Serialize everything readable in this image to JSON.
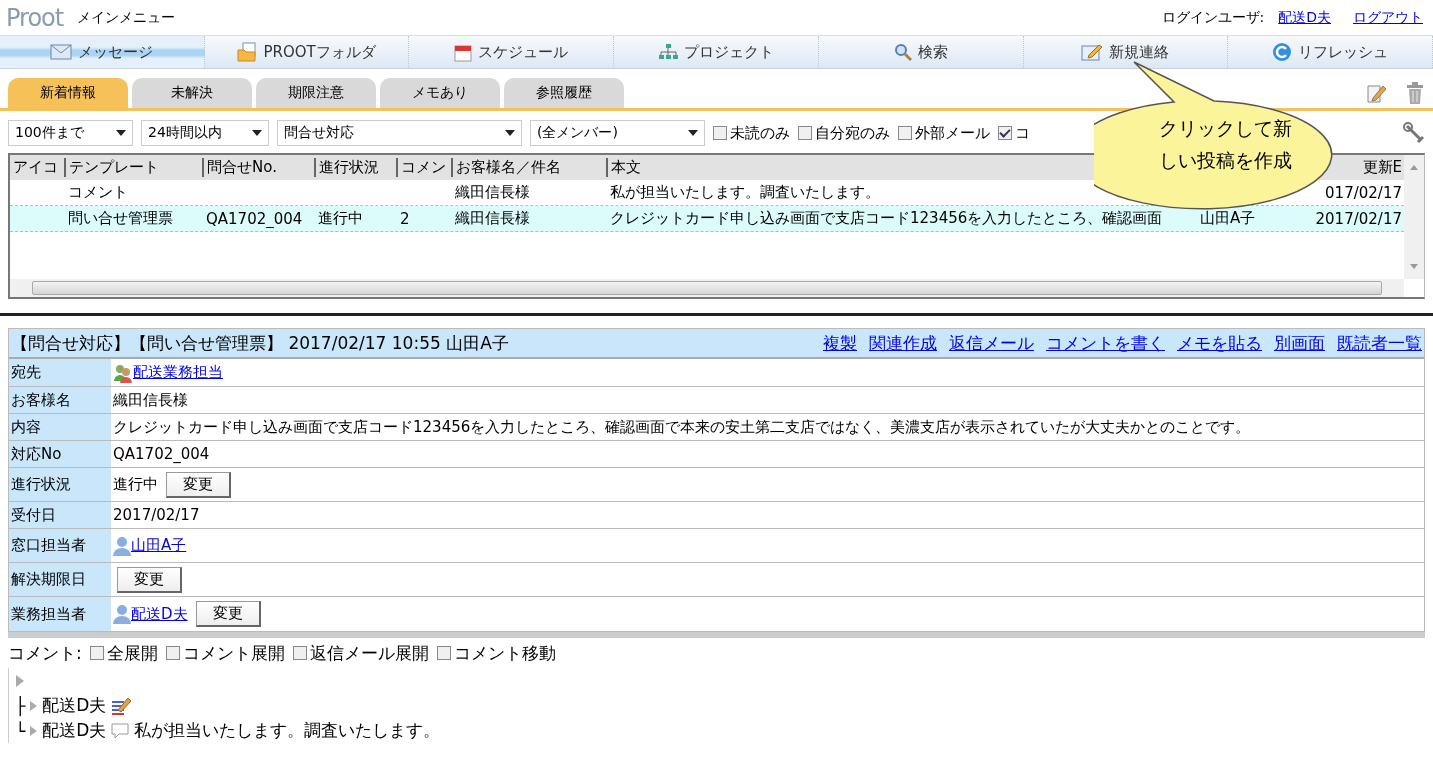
{
  "header": {
    "logo": "Proot",
    "title": "メインメニュー",
    "login_label": "ログインユーザ:",
    "user": "配送D夫",
    "logout": "ログアウト"
  },
  "nav": [
    {
      "label": "メッセージ",
      "kind": "mail",
      "selected": true
    },
    {
      "label": "PROOTフォルダ",
      "kind": "folder",
      "selected": false
    },
    {
      "label": "スケジュール",
      "kind": "calendar",
      "selected": false
    },
    {
      "label": "プロジェクト",
      "kind": "org",
      "selected": false
    },
    {
      "label": "検索",
      "kind": "search",
      "selected": false
    },
    {
      "label": "新規連絡",
      "kind": "edit",
      "selected": false
    },
    {
      "label": "リフレッシュ",
      "kind": "refresh",
      "selected": false
    }
  ],
  "tabs": [
    {
      "label": "新着情報",
      "selected": true
    },
    {
      "label": "未解決",
      "selected": false
    },
    {
      "label": "期限注意",
      "selected": false
    },
    {
      "label": "メモあり",
      "selected": false
    },
    {
      "label": "参照履歴",
      "selected": false
    }
  ],
  "filters": {
    "selects": [
      "100件まで",
      "24時間以内",
      "問合せ対応",
      "(全メンバー)"
    ],
    "checkboxes": [
      {
        "label": "未読のみ",
        "checked": false
      },
      {
        "label": "自分宛のみ",
        "checked": false
      },
      {
        "label": "外部メール",
        "checked": false
      },
      {
        "label": "コ",
        "checked": true
      }
    ]
  },
  "table": {
    "columns": [
      "アイコ",
      "テンプレート",
      "問合せNo.",
      "進行状況",
      "コメン",
      "お客様名／件名",
      "本文",
      "更新E"
    ],
    "rows": [
      {
        "highlighted": false,
        "template": "コメント",
        "customer": "織田信長様",
        "body": "私が担当いたします。調査いたします。",
        "updated": "017/02/17"
      },
      {
        "highlighted": true,
        "template": "問い合せ管理票",
        "inquiry_no": "QA1702_004",
        "status": "進行中",
        "comments": "2",
        "customer": "織田信長様",
        "body": "クレジットカード申し込み画面で支店コード123456を入力したところ、確認画面",
        "author": "山田A子",
        "updated": "2017/02/17"
      }
    ]
  },
  "callout": "クリックして新しい投稿を作成",
  "detail": {
    "title": "【問合せ対応】【問い合せ管理票】 2017/02/17 10:55 山田A子",
    "actions": [
      "複製",
      "関連作成",
      "返信メール",
      "コメントを書く",
      "メモを貼る",
      "別画面",
      "既読者一覧"
    ],
    "fields": [
      {
        "label": "宛先",
        "kind": "group",
        "link": "配送業務担当"
      },
      {
        "label": "お客様名",
        "text": "織田信長様"
      },
      {
        "label": "内容",
        "text": "クレジットカード申し込み画面で支店コード123456を入力したところ、確認画面で本来の安土第二支店ではなく、美濃支店が表示されていたが大丈夫かとのことです。"
      },
      {
        "label": "対応No",
        "text": "QA1702_004"
      },
      {
        "label": "進行状況",
        "text": "進行中",
        "button": "変更"
      },
      {
        "label": "受付日",
        "text": "2017/02/17"
      },
      {
        "label": "窓口担当者",
        "kind": "user",
        "link": "山田A子"
      },
      {
        "label": "解決期限日",
        "button": "変更"
      },
      {
        "label": "業務担当者",
        "kind": "user",
        "link": "配送D夫",
        "button": "変更"
      }
    ]
  },
  "comments": {
    "label": "コメント:",
    "options": [
      {
        "label": "全展開",
        "checked": false
      },
      {
        "label": "コメント展開",
        "checked": false
      },
      {
        "label": "返信メール展開",
        "checked": false
      },
      {
        "label": "コメント移動",
        "checked": false
      }
    ],
    "thread": {
      "children": [
        {
          "connector": "├",
          "author": "配送D夫",
          "kind": "memo"
        },
        {
          "connector": "└",
          "author": "配送D夫",
          "kind": "speech",
          "text": "私が担当いたします。調査いたします。"
        }
      ]
    }
  }
}
